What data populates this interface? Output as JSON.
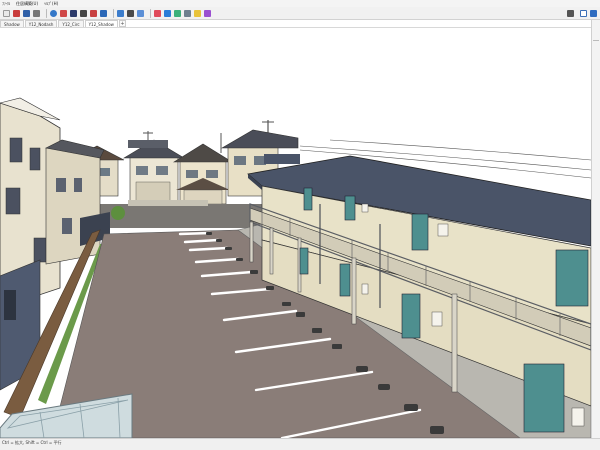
{
  "window": {
    "menu": [
      "ﾌｧｲﾙ",
      "住居構築(U)",
      "ﾍﾙﾌﾟ(H)"
    ]
  },
  "toolbar": {
    "groups": [
      [
        "new-doc-icon",
        "save-icon",
        "open-icon",
        "cut-icon"
      ],
      [
        "orbit-icon",
        "zoom-icon",
        "pan-icon",
        "fit-icon",
        "walk-icon",
        "camera-icon"
      ],
      [
        "layer-icon",
        "view-icon",
        "settings-icon"
      ],
      [
        "red-tool-icon",
        "blue-tool-icon",
        "green-tool-icon",
        "gray-tool-icon",
        "yellow-tool-icon",
        "purple-tool-icon"
      ]
    ],
    "right": [
      "exit-icon",
      "document-icon",
      "users-icon"
    ]
  },
  "tabs": [
    {
      "label": "Shadow"
    },
    {
      "label": "Y12_Nodash"
    },
    {
      "label": "Y12_Circ"
    },
    {
      "label": "Y12_Shadow",
      "active": true
    }
  ],
  "tab_add": "+",
  "status": {
    "text": "Ctrl = 拡大, Shift = Ctrl = 平行"
  },
  "colors": {
    "roof": "#4a5468",
    "roof_light": "#5d6880",
    "wall": "#e8e2c8",
    "door": "#4e8f8f",
    "parking": "#8a7d78",
    "sidewalk": "#b9b7b0",
    "sky": "#ffffff",
    "grass": "#7db35c"
  }
}
